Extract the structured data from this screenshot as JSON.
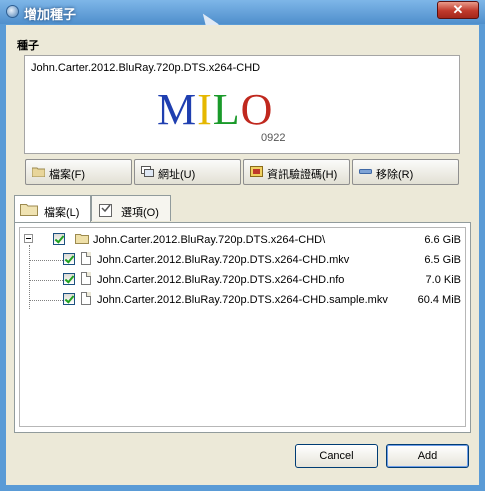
{
  "window": {
    "title": "增加種子"
  },
  "torrent": {
    "section_label": "種子",
    "name": "John.Carter.2012.BluRay.720p.DTS.x264-CHD",
    "logo_text": [
      "M",
      "I",
      "L",
      "O"
    ],
    "logo_sub": "0922"
  },
  "toolbar": {
    "files_label": "檔案(F)",
    "url_label": "網址(U)",
    "hash_label": "資訊驗證碼(H)",
    "remove_label": "移除(R)"
  },
  "tabs": [
    {
      "label": "檔案(L)"
    },
    {
      "label": "選項(O)"
    }
  ],
  "files": [
    {
      "name": "John.Carter.2012.BluRay.720p.DTS.x264-CHD\\",
      "size": "6.6 GiB",
      "type": "folder"
    },
    {
      "name": "John.Carter.2012.BluRay.720p.DTS.x264-CHD.mkv",
      "size": "6.5 GiB",
      "type": "file"
    },
    {
      "name": "John.Carter.2012.BluRay.720p.DTS.x264-CHD.nfo",
      "size": "7.0 KiB",
      "type": "file"
    },
    {
      "name": "John.Carter.2012.BluRay.720p.DTS.x264-CHD.sample.mkv",
      "size": "60.4 MiB",
      "type": "file"
    }
  ],
  "dialog": {
    "cancel_label": "Cancel",
    "add_label": "Add"
  },
  "colors": {
    "logo": [
      "#1f3fb0",
      "#e5b700",
      "#1a9a2a",
      "#c0281e"
    ]
  }
}
